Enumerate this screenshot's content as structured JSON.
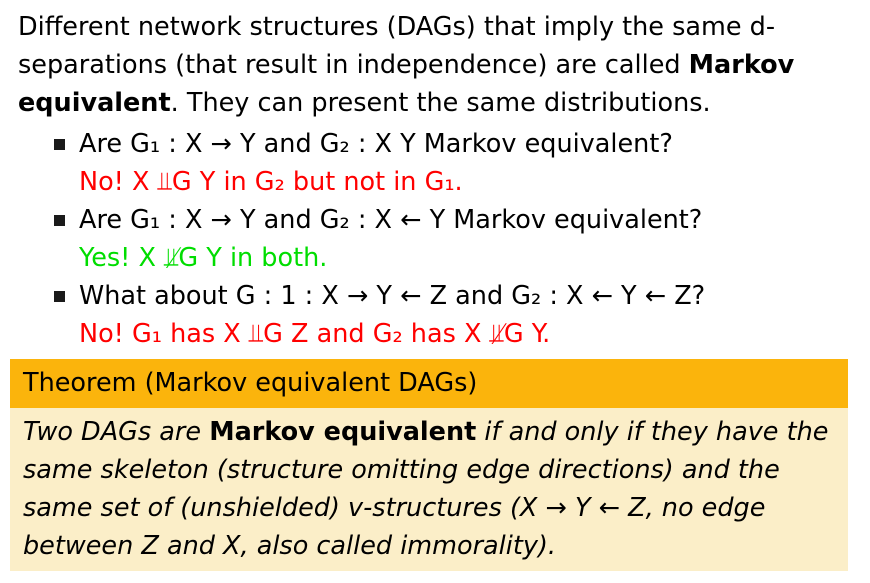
{
  "intro": {
    "part1": "Different network structures (DAGs) that imply the same d-separations (that result in independence) are called ",
    "bold": "Markov equivalent",
    "part2": ". They can present the same distributions."
  },
  "items": [
    {
      "question": "Are G₁ : X → Y and G₂ : X    Y Markov equivalent?",
      "answer": "No!  X ⫫G Y in G₂ but not in G₁.",
      "answer_color": "#ff0000"
    },
    {
      "question": "Are G₁ : X → Y and G₂ : X ← Y Markov equivalent?",
      "answer": "Yes!  X ⫫̸G Y in both.",
      "answer_color": "#00dd00"
    },
    {
      "question": "What about G : 1 : X → Y ← Z and G₂ : X ← Y ← Z?",
      "answer": "No!  G₁ has X ⫫G Z and G₂ has X ⫫̸G Y.",
      "answer_color": "#ff0000"
    }
  ],
  "theorem": {
    "title": "Theorem (Markov equivalent DAGs)",
    "body_part1": "Two DAGs are ",
    "body_bold": "Markov equivalent",
    "body_part2": " if and only if they have the same skeleton (structure omitting edge directions) and the same set of (unshielded) v-structures (X → Y ← Z, no edge between Z and X, also called immorality).",
    "header_color": "#fbb40c",
    "body_color": "#fbeec8"
  }
}
